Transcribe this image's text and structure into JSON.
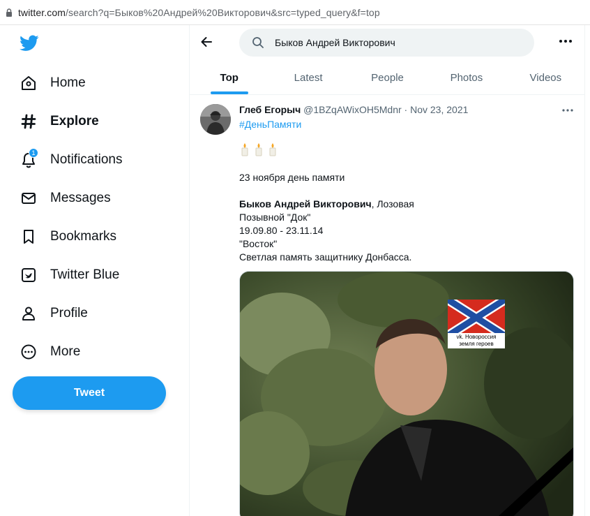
{
  "browser": {
    "url_host": "twitter.com",
    "url_rest": "/search?q=Быков%20Андрей%20Викторович&src=typed_query&f=top"
  },
  "sidebar": {
    "logo_icon": "twitter-bird-icon",
    "items": [
      {
        "label": "Home",
        "icon": "home-icon",
        "active": false
      },
      {
        "label": "Explore",
        "icon": "hashtag-icon",
        "active": true
      },
      {
        "label": "Notifications",
        "icon": "bell-icon",
        "active": false,
        "badge": "1"
      },
      {
        "label": "Messages",
        "icon": "envelope-icon",
        "active": false
      },
      {
        "label": "Bookmarks",
        "icon": "bookmark-icon",
        "active": false
      },
      {
        "label": "Twitter Blue",
        "icon": "twitter-blue-icon",
        "active": false
      },
      {
        "label": "Profile",
        "icon": "person-icon",
        "active": false
      },
      {
        "label": "More",
        "icon": "more-circle-icon",
        "active": false
      }
    ],
    "tweet_button": "Tweet"
  },
  "search": {
    "value": "Быков Андрей Викторович"
  },
  "tabs": [
    {
      "label": "Top",
      "active": true
    },
    {
      "label": "Latest",
      "active": false
    },
    {
      "label": "People",
      "active": false
    },
    {
      "label": "Photos",
      "active": false
    },
    {
      "label": "Videos",
      "active": false
    }
  ],
  "tweet": {
    "name": "Глеб Егорыч",
    "handle": "@1BZqAWixOH5Mdnr",
    "sep": " · ",
    "date": "Nov 23, 2021",
    "hashtag": "#ДеньПамяти",
    "line1": "23 ноября день памяти",
    "line2_bold": "Быков Андрей Викторович",
    "line2_rest": ", Лозовая",
    "line3": "Позывной \"Док\"",
    "line4": "19.09.80 - 23.11.14",
    "line5": "\"Восток\"",
    "line6": "Светлая память защитнику Донбасса.",
    "image_caption_1": "vk. Новороссия",
    "image_caption_2": "земля героев"
  },
  "colors": {
    "accent": "#1d9bf0",
    "text": "#0f1419",
    "secondary": "#536471"
  }
}
